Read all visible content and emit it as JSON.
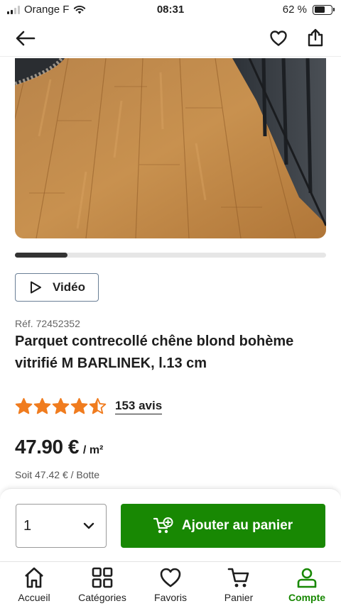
{
  "status_bar": {
    "carrier": "Orange F",
    "time": "08:31",
    "battery": "62 %",
    "battery_level": 0.62
  },
  "header": {
    "back_icon": "arrow-left-icon",
    "favorite_icon": "heart-outline-icon",
    "share_icon": "share-upload-icon"
  },
  "gallery": {
    "progress": 0.17
  },
  "video_button": {
    "label": "Vidéo",
    "icon": "play-outline-icon"
  },
  "product": {
    "reference": "Réf. 72452352",
    "title": "Parquet contrecollé chêne blond bohème vitrifié M BARLINEK, l.13 cm",
    "rating": 4.5,
    "max_rating": 5,
    "reviews_label": "153 avis",
    "price": "47.90 €",
    "price_unit": "/ m²",
    "sub_price": "Soit 47.42 € / Botte"
  },
  "purchase": {
    "quantity": "1",
    "add_to_cart_label": "Ajouter au panier"
  },
  "tabs": [
    {
      "label": "Accueil",
      "icon": "home-icon",
      "active": false
    },
    {
      "label": "Catégories",
      "icon": "grid-icon",
      "active": false
    },
    {
      "label": "Favoris",
      "icon": "heart-icon",
      "active": false
    },
    {
      "label": "Panier",
      "icon": "cart-icon",
      "active": false
    },
    {
      "label": "Compte",
      "icon": "user-icon",
      "active": true
    }
  ],
  "colors": {
    "primary_green": "#188803",
    "star_orange": "#f07c1f",
    "text": "#1e1e1e"
  }
}
